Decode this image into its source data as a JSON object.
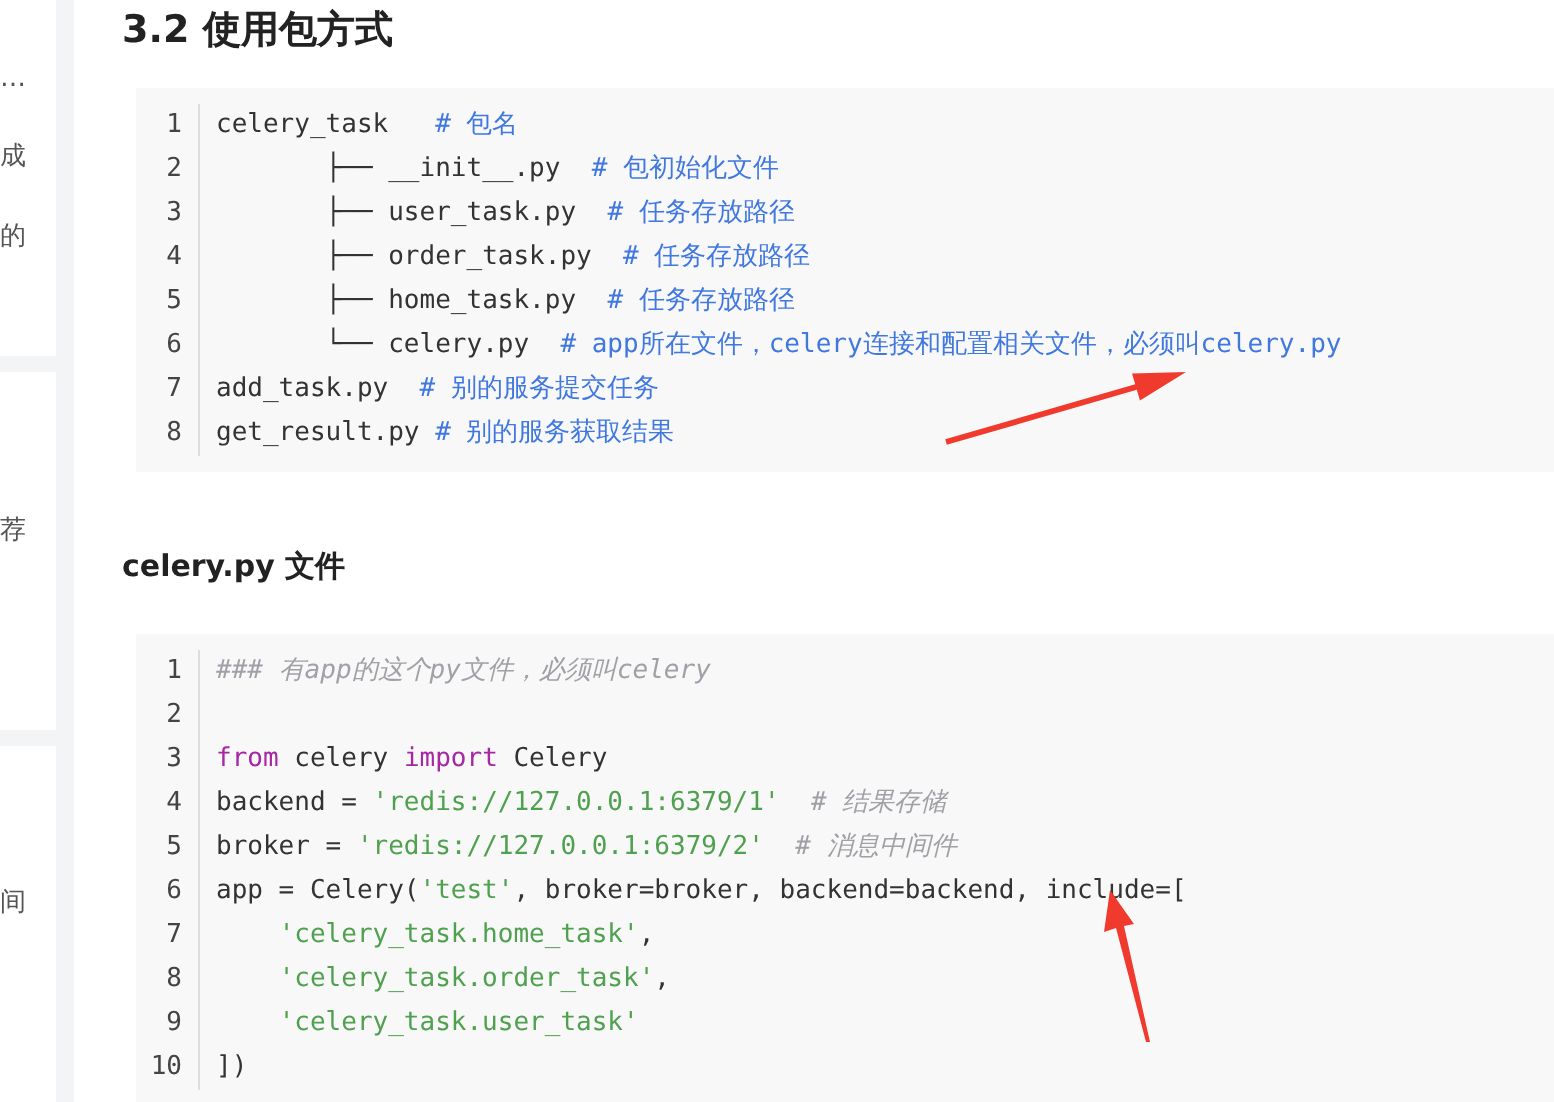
{
  "sidebar": {
    "cards": [
      {
        "fragments": [
          "…",
          "成",
          "的"
        ]
      },
      {
        "fragments": [
          "荐"
        ]
      },
      {
        "fragments": [
          "间"
        ]
      }
    ]
  },
  "sections": [
    {
      "heading": "3.2 使用包方式",
      "kind": "section",
      "code": [
        {
          "number": "1",
          "tokens": [
            {
              "kind": "plain",
              "text": "celery_task   "
            },
            {
              "kind": "comment",
              "text": "# 包名"
            }
          ]
        },
        {
          "number": "2",
          "tokens": [
            {
              "kind": "plain",
              "text": "       ├── __init__.py  "
            },
            {
              "kind": "comment",
              "text": "# 包初始化文件"
            }
          ]
        },
        {
          "number": "3",
          "tokens": [
            {
              "kind": "plain",
              "text": "       ├── user_task.py  "
            },
            {
              "kind": "comment",
              "text": "# 任务存放路径"
            }
          ]
        },
        {
          "number": "4",
          "tokens": [
            {
              "kind": "plain",
              "text": "       ├── order_task.py  "
            },
            {
              "kind": "comment",
              "text": "# 任务存放路径"
            }
          ]
        },
        {
          "number": "5",
          "tokens": [
            {
              "kind": "plain",
              "text": "       ├── home_task.py  "
            },
            {
              "kind": "comment",
              "text": "# 任务存放路径"
            }
          ]
        },
        {
          "number": "6",
          "tokens": [
            {
              "kind": "plain",
              "text": "       └── celery.py  "
            },
            {
              "kind": "comment",
              "text": "# app所在文件，celery连接和配置相关文件，必须叫celery.py"
            }
          ]
        },
        {
          "number": "7",
          "tokens": [
            {
              "kind": "plain",
              "text": "add_task.py  "
            },
            {
              "kind": "comment",
              "text": "# 别的服务提交任务"
            }
          ]
        },
        {
          "number": "8",
          "tokens": [
            {
              "kind": "plain",
              "text": "get_result.py "
            },
            {
              "kind": "comment",
              "text": "# 别的服务获取结果"
            }
          ]
        }
      ]
    },
    {
      "heading": "celery.py 文件",
      "kind": "subsection",
      "code": [
        {
          "number": "1",
          "tokens": [
            {
              "kind": "doc-comment",
              "text": "### 有app的这个py文件，必须叫celery"
            }
          ]
        },
        {
          "number": "2"
        },
        {
          "number": "3",
          "tokens": [
            {
              "kind": "keyword",
              "text": "from"
            },
            {
              "kind": "plain",
              "text": " celery "
            },
            {
              "kind": "keyword",
              "text": "import"
            },
            {
              "kind": "plain",
              "text": " Celery"
            }
          ]
        },
        {
          "number": "4",
          "tokens": [
            {
              "kind": "plain",
              "text": "backend = "
            },
            {
              "kind": "string",
              "text": "'redis://127.0.0.1:6379/1'"
            },
            {
              "kind": "doc-comment",
              "text": "  # 结果存储"
            }
          ]
        },
        {
          "number": "5",
          "tokens": [
            {
              "kind": "plain",
              "text": "broker = "
            },
            {
              "kind": "string",
              "text": "'redis://127.0.0.1:6379/2'"
            },
            {
              "kind": "doc-comment",
              "text": "  # 消息中间件"
            }
          ]
        },
        {
          "number": "6",
          "tokens": [
            {
              "kind": "plain",
              "text": "app = Celery("
            },
            {
              "kind": "string",
              "text": "'test'"
            },
            {
              "kind": "plain",
              "text": ", broker=broker, backend=backend, include=["
            }
          ]
        },
        {
          "number": "7",
          "tokens": [
            {
              "kind": "string",
              "text": "    'celery_task.home_task'"
            },
            {
              "kind": "plain",
              "text": ","
            }
          ]
        },
        {
          "number": "8",
          "tokens": [
            {
              "kind": "string",
              "text": "    'celery_task.order_task'"
            },
            {
              "kind": "plain",
              "text": ","
            }
          ]
        },
        {
          "number": "9",
          "tokens": [
            {
              "kind": "string",
              "text": "    'celery_task.user_task'"
            }
          ]
        },
        {
          "number": "10",
          "tokens": [
            {
              "kind": "plain",
              "text": "])"
            }
          ]
        }
      ]
    }
  ]
}
